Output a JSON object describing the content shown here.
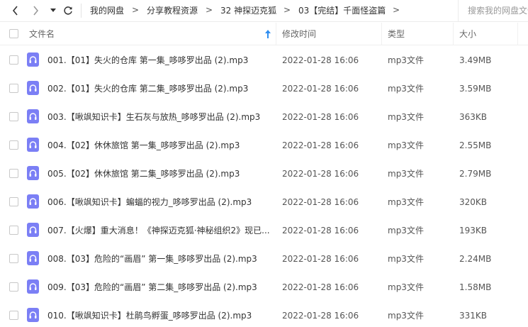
{
  "nav": {
    "breadcrumbs": [
      "我的网盘",
      "分享教程资源",
      "32 神探迈克狐",
      "03【完结】千面怪盗篇"
    ],
    "separator": ">",
    "search_placeholder": "搜索我的网盘文件"
  },
  "table": {
    "columns": {
      "name": "文件名",
      "modified": "修改时间",
      "type": "类型",
      "size": "大小"
    },
    "sort": "name ascending",
    "rows": [
      {
        "name": "001.【01】失火的仓库 第一集_哆哆罗出品 (2).mp3",
        "modified": "2022-01-28 16:06",
        "type": "mp3文件",
        "size": "3.49MB"
      },
      {
        "name": "002.【01】失火的仓库 第二集_哆哆罗出品 (2).mp3",
        "modified": "2022-01-28 16:06",
        "type": "mp3文件",
        "size": "3.59MB"
      },
      {
        "name": "003.【啾飒知识卡】生石灰与放热_哆哆罗出品 (2).mp3",
        "modified": "2022-01-28 16:06",
        "type": "mp3文件",
        "size": "363KB"
      },
      {
        "name": "004.【02】休休旅馆 第一集_哆哆罗出品 (2).mp3",
        "modified": "2022-01-28 16:06",
        "type": "mp3文件",
        "size": "2.55MB"
      },
      {
        "name": "005.【02】休休旅馆 第二集_哆哆罗出品 (2).mp3",
        "modified": "2022-01-28 16:06",
        "type": "mp3文件",
        "size": "2.79MB"
      },
      {
        "name": "006.【啾飒知识卡】蝙蝠的视力_哆哆罗出品 (2).mp3",
        "modified": "2022-01-28 16:06",
        "type": "mp3文件",
        "size": "320KB"
      },
      {
        "name": "007.【火爆】重大消息！《神探迈克狐·神秘组织2》现已...",
        "modified": "2022-01-28 16:06",
        "type": "mp3文件",
        "size": "193KB"
      },
      {
        "name": "008.【03】危险的“画眉” 第一集_哆哆罗出品 (2).mp3",
        "modified": "2022-01-28 16:06",
        "type": "mp3文件",
        "size": "2.24MB"
      },
      {
        "name": "009.【03】危险的“画眉” 第二集_哆哆罗出品 (2).mp3",
        "modified": "2022-01-28 16:06",
        "type": "mp3文件",
        "size": "1.58MB"
      },
      {
        "name": "010.【啾飒知识卡】杜鹃鸟孵蛋_哆哆罗出品 (2).mp3",
        "modified": "2022-01-28 16:06",
        "type": "mp3文件",
        "size": "331KB"
      }
    ]
  },
  "colors": {
    "audio_icon": "#7b7ff5",
    "sort_arrow": "#2f8ef0"
  },
  "icons": {
    "back": "chevron-left-icon",
    "forward": "chevron-right-icon",
    "history": "caret-down-icon",
    "refresh": "refresh-icon",
    "file": "audio-file-icon",
    "sort": "sort-up-arrow-icon"
  }
}
